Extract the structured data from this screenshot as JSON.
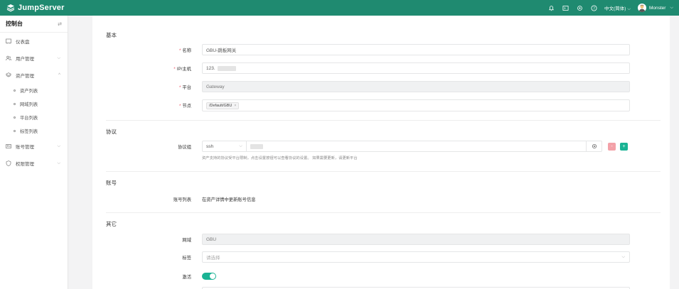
{
  "brand": {
    "name": "JumpServer",
    "color": "#1f8a70"
  },
  "topbar": {
    "language": "中文(简体)",
    "user": "Monster"
  },
  "sidebar": {
    "title": "控制台",
    "items": [
      {
        "label": "仪表盘",
        "icon": "dashboard-icon"
      },
      {
        "label": "用户管理",
        "icon": "users-icon"
      },
      {
        "label": "资产管理",
        "icon": "assets-icon"
      },
      {
        "label": "账号管理",
        "icon": "accounts-icon"
      },
      {
        "label": "权限管理",
        "icon": "permissions-icon"
      }
    ],
    "sub_items": [
      "资产列表",
      "网域列表",
      "平台列表",
      "标签列表"
    ]
  },
  "form": {
    "basic": {
      "title": "基本",
      "name_label": "名称",
      "name_value": "GBU-跳板网关",
      "ip_label": "IP/主机",
      "ip_value": "123.",
      "platform_label": "平台",
      "platform_value": "Gateway",
      "node_label": "节点",
      "node_tag": "/Default/GBU"
    },
    "protocol": {
      "title": "协议",
      "group_label": "协议组",
      "protocol_value": "ssh",
      "help": "资产支持的协议受平台限制，点击设置按钮可以查看协议的设置。 如果需要更新，请更新平台",
      "minus": "-",
      "plus": "+"
    },
    "account": {
      "title": "账号",
      "list_label": "账号列表",
      "list_text": "在资产详情中更新账号信息"
    },
    "other": {
      "title": "其它",
      "domain_label": "网域",
      "domain_value": "GBU",
      "labels_label": "标签",
      "labels_placeholder": "请选择",
      "active_label": "激活",
      "active": true
    }
  }
}
